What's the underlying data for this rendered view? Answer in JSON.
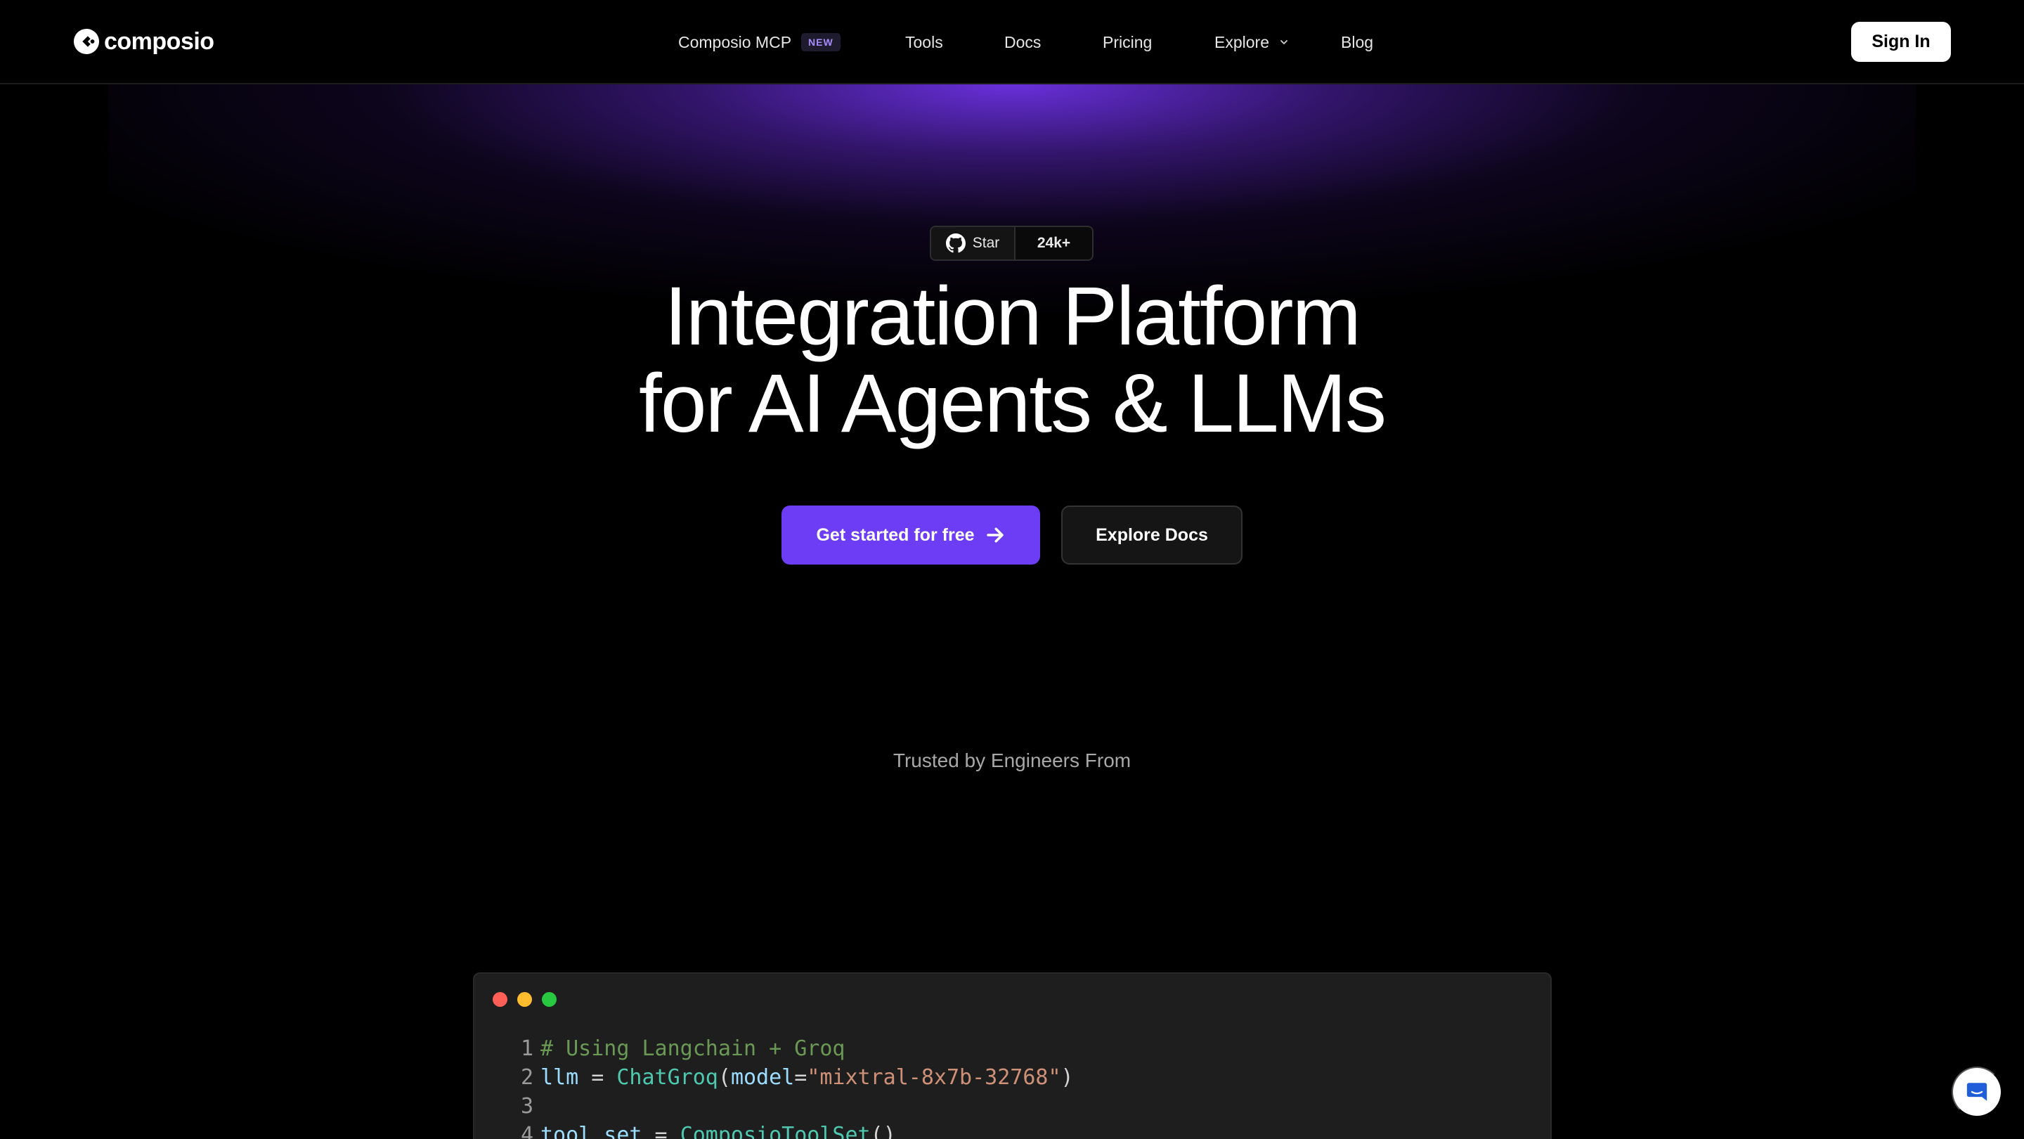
{
  "brand": {
    "name": "composio"
  },
  "nav": {
    "items": [
      {
        "label": "Composio MCP",
        "badge": "NEW"
      },
      {
        "label": "Tools"
      },
      {
        "label": "Docs"
      },
      {
        "label": "Pricing"
      },
      {
        "label": "Explore",
        "has_dropdown": true
      },
      {
        "label": "Blog"
      }
    ],
    "signin_label": "Sign In"
  },
  "github": {
    "star_label": "Star",
    "count": "24k+"
  },
  "hero": {
    "line1": "Integration Platform",
    "line2": "for AI Agents & LLMs",
    "cta_primary": "Get started for free",
    "cta_secondary": "Explore Docs",
    "trusted": "Trusted by Engineers From"
  },
  "code": {
    "lines": [
      {
        "n": "1",
        "tokens": [
          {
            "t": "# Using Langchain + Groq",
            "k": "comment"
          }
        ]
      },
      {
        "n": "2",
        "tokens": [
          {
            "t": "llm",
            "k": "var"
          },
          {
            "t": " = ",
            "k": "op"
          },
          {
            "t": "ChatGroq",
            "k": "func"
          },
          {
            "t": "(",
            "k": "punc"
          },
          {
            "t": "model",
            "k": "param"
          },
          {
            "t": "=",
            "k": "op"
          },
          {
            "t": "\"mixtral-8x7b-32768\"",
            "k": "str"
          },
          {
            "t": ")",
            "k": "punc"
          }
        ]
      },
      {
        "n": "3",
        "tokens": []
      },
      {
        "n": "4",
        "tokens": [
          {
            "t": "tool_set",
            "k": "var"
          },
          {
            "t": " = ",
            "k": "op"
          },
          {
            "t": "ComposioToolSet",
            "k": "func"
          },
          {
            "t": "()",
            "k": "punc"
          }
        ]
      }
    ]
  },
  "colors": {
    "accent": "#6d3df5",
    "dot_red": "#ff5f57",
    "dot_yellow": "#febc2e",
    "dot_green": "#28c840",
    "chat_icon": "#1f5ed8"
  },
  "icons": {
    "logo": "composio-logo-icon",
    "github": "github-icon",
    "arrow": "arrow-right-icon",
    "dropdown": "chevron-down-icon",
    "chat": "chat-bubble-icon"
  }
}
